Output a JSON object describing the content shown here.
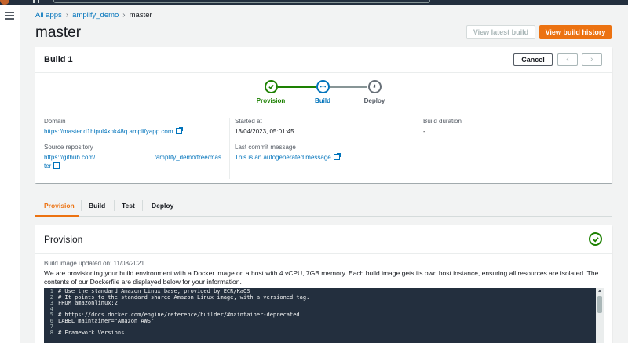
{
  "breadcrumb": {
    "all_apps": "All apps",
    "app": "amplify_demo",
    "current": "master"
  },
  "page_title": "master",
  "header_buttons": {
    "latest": "View latest build",
    "history": "View build history"
  },
  "build": {
    "title": "Build 1",
    "cancel": "Cancel",
    "prev_icon": "‹",
    "next_icon": "›",
    "steps": [
      {
        "label": "Provision",
        "state": "complete"
      },
      {
        "label": "Build",
        "state": "in-progress"
      },
      {
        "label": "Deploy",
        "state": "pending"
      }
    ],
    "details": {
      "domain_label": "Domain",
      "domain_value": "https://master.d1hipul4xpk48q.amplifyapp.com",
      "repo_label": "Source repository",
      "repo_part1": "https://github.com/",
      "repo_part2": "/amplify_demo/tree/mas",
      "repo_part3": "ter",
      "started_label": "Started at",
      "started_value": "13/04/2023, 05:01:45",
      "commit_label": "Last commit message",
      "commit_value": "This is an autogenerated message",
      "duration_label": "Build duration",
      "duration_value": "-"
    }
  },
  "tabs": [
    "Provision",
    "Build",
    "Test",
    "Deploy"
  ],
  "provision": {
    "title": "Provision",
    "image_updated": "Build image updated on: 11/08/2021",
    "description": "We are provisioning your build environment with a Docker image on a host with 4 vCPU, 7GB memory. Each build image gets its own host instance, ensuring all resources are isolated. The contents of our Dockerfile are displayed below for your information.",
    "code": [
      {
        "n": "1",
        "t": "# Use the standard Amazon Linux base, provided by ECR/KaOS"
      },
      {
        "n": "2",
        "t": "# It points to the standard shared Amazon Linux image, with a versioned tag."
      },
      {
        "n": "3",
        "t": "FROM amazonlinux:2"
      },
      {
        "n": "4",
        "t": ""
      },
      {
        "n": "5",
        "t": "# https://docs.docker.com/engine/reference/builder/#maintainer-deprecated"
      },
      {
        "n": "6",
        "t": "LABEL maintainer=\"Amazon AWS\""
      },
      {
        "n": "7",
        "t": ""
      },
      {
        "n": "8",
        "t": "# Framework Versions"
      }
    ]
  },
  "colors": {
    "accent": "#ec7211",
    "link": "#0073bb",
    "success": "#1d8102",
    "code_bg": "#232f3e"
  }
}
